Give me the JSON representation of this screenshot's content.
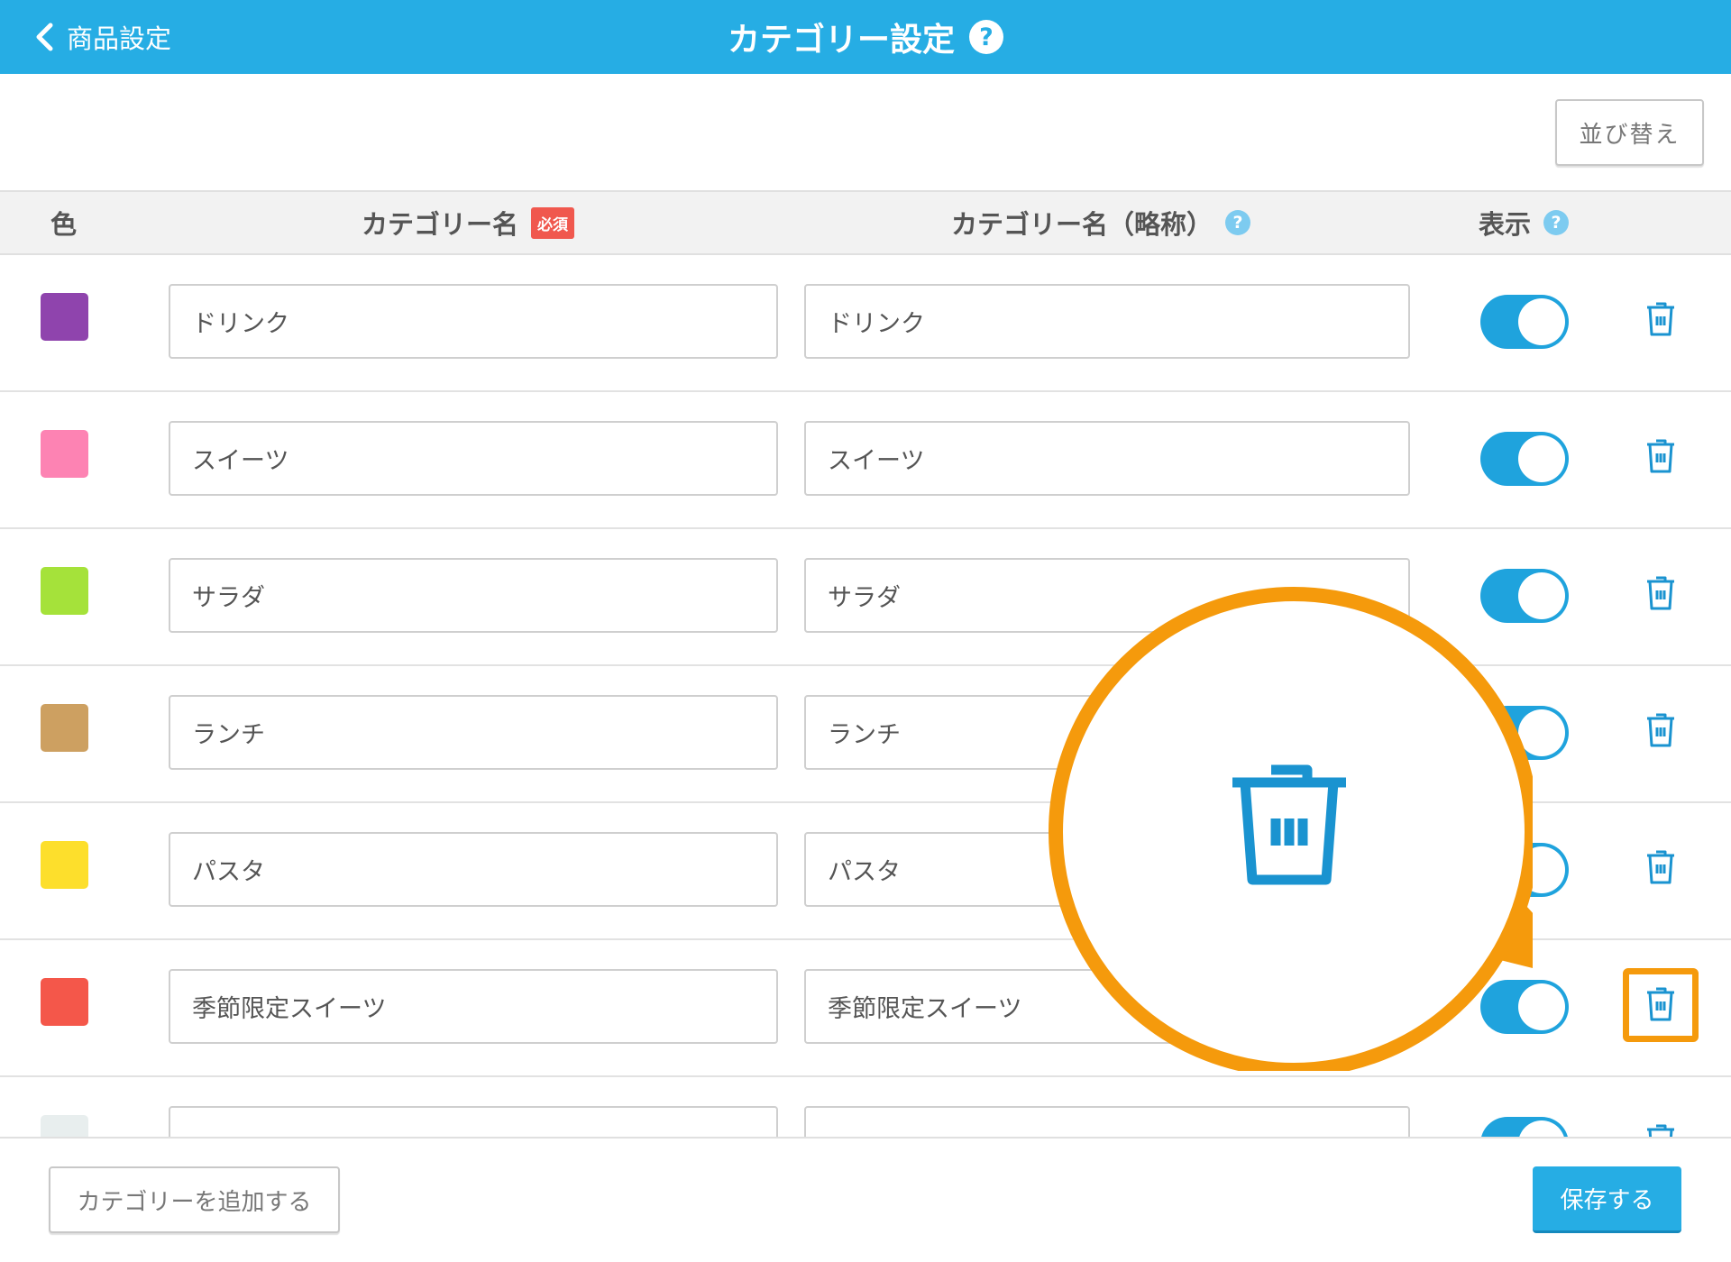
{
  "header": {
    "back_label": "商品設定",
    "title": "カテゴリー設定",
    "help_glyph": "?",
    "background_color": "#26ade4"
  },
  "toolbar": {
    "sort_label": "並び替え"
  },
  "table": {
    "columns": {
      "color": "色",
      "name": "カテゴリー名",
      "required_badge": "必須",
      "abbr": "カテゴリー名（略称）",
      "display": "表示"
    },
    "rows": [
      {
        "color": "#8f44ad",
        "name": "ドリンク",
        "abbr": "ドリンク",
        "visible": true
      },
      {
        "color": "#fd83b3",
        "name": "スイーツ",
        "abbr": "スイーツ",
        "visible": true
      },
      {
        "color": "#a5e23a",
        "name": "サラダ",
        "abbr": "サラダ",
        "visible": true
      },
      {
        "color": "#cda061",
        "name": "ランチ",
        "abbr": "ランチ",
        "visible": true
      },
      {
        "color": "#fddf2c",
        "name": "パスタ",
        "abbr": "パスタ",
        "visible": true
      },
      {
        "color": "#f4574a",
        "name": "季節限定スイーツ",
        "abbr": "季節限定スイーツ",
        "visible": true
      },
      {
        "color": "#e8eeee",
        "name": "",
        "abbr": "",
        "visible": true
      }
    ]
  },
  "footer": {
    "add_label": "カテゴリーを追加する",
    "save_label": "保存する"
  },
  "annotation": {
    "highlight_color": "#f59a0c",
    "icon": "trash-icon"
  }
}
